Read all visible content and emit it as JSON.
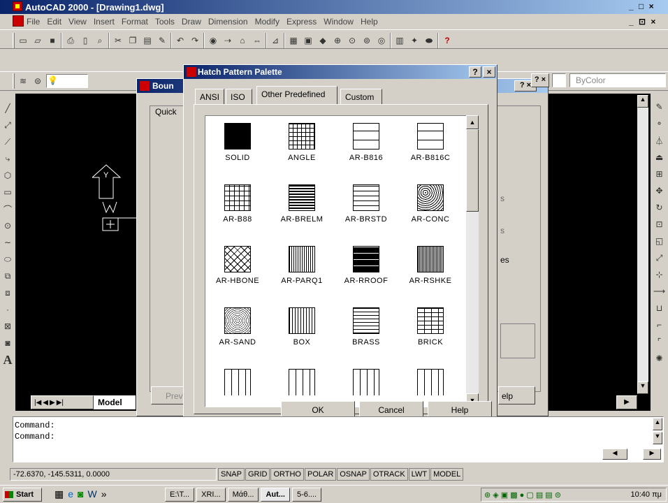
{
  "window": {
    "title": "AutoCAD 2000 - [Drawing1.dwg]",
    "controls": "_ □ ×",
    "mdi_controls": "_ ⊡ ×"
  },
  "menu": [
    "File",
    "Edit",
    "View",
    "Insert",
    "Format",
    "Tools",
    "Draw",
    "Dimension",
    "Modify",
    "Express",
    "Window",
    "Help"
  ],
  "properties": {
    "color": "ByColor"
  },
  "background_dialog": {
    "title_visible": "Boun",
    "tab_visible": "Quick",
    "fragment_s": "s",
    "fragment_es": "es",
    "preview_button": "Prev",
    "help_fragment": "elp"
  },
  "model_tabs": {
    "active": "Model"
  },
  "palette": {
    "title": "Hatch Pattern Palette",
    "tabs": [
      "ANSI",
      "ISO",
      "Other Predefined",
      "Custom"
    ],
    "active_tab": "Other Predefined",
    "patterns": [
      "SOLID",
      "ANGLE",
      "AR-B816",
      "AR-B816C",
      "AR-B88",
      "AR-BRELM",
      "AR-BRSTD",
      "AR-CONC",
      "AR-HBONE",
      "AR-PARQ1",
      "AR-RROOF",
      "AR-RSHKE",
      "AR-SAND",
      "BOX",
      "BRASS",
      "BRICK"
    ],
    "buttons": {
      "ok": "OK",
      "cancel": "Cancel",
      "help": "Help"
    }
  },
  "command": {
    "lines": [
      "Command:",
      "Command:"
    ]
  },
  "status": {
    "coords": "-72.6370, -145.5311, 0.0000",
    "toggles": [
      "SNAP",
      "GRID",
      "ORTHO",
      "POLAR",
      "OSNAP",
      "OTRACK",
      "LWT",
      "MODEL"
    ]
  },
  "taskbar": {
    "start": "Start",
    "items": [
      "E:\\T...",
      "XRI...",
      "Μάθ...",
      "Aut...",
      "5-6...."
    ],
    "clock": "10:40 πμ"
  }
}
